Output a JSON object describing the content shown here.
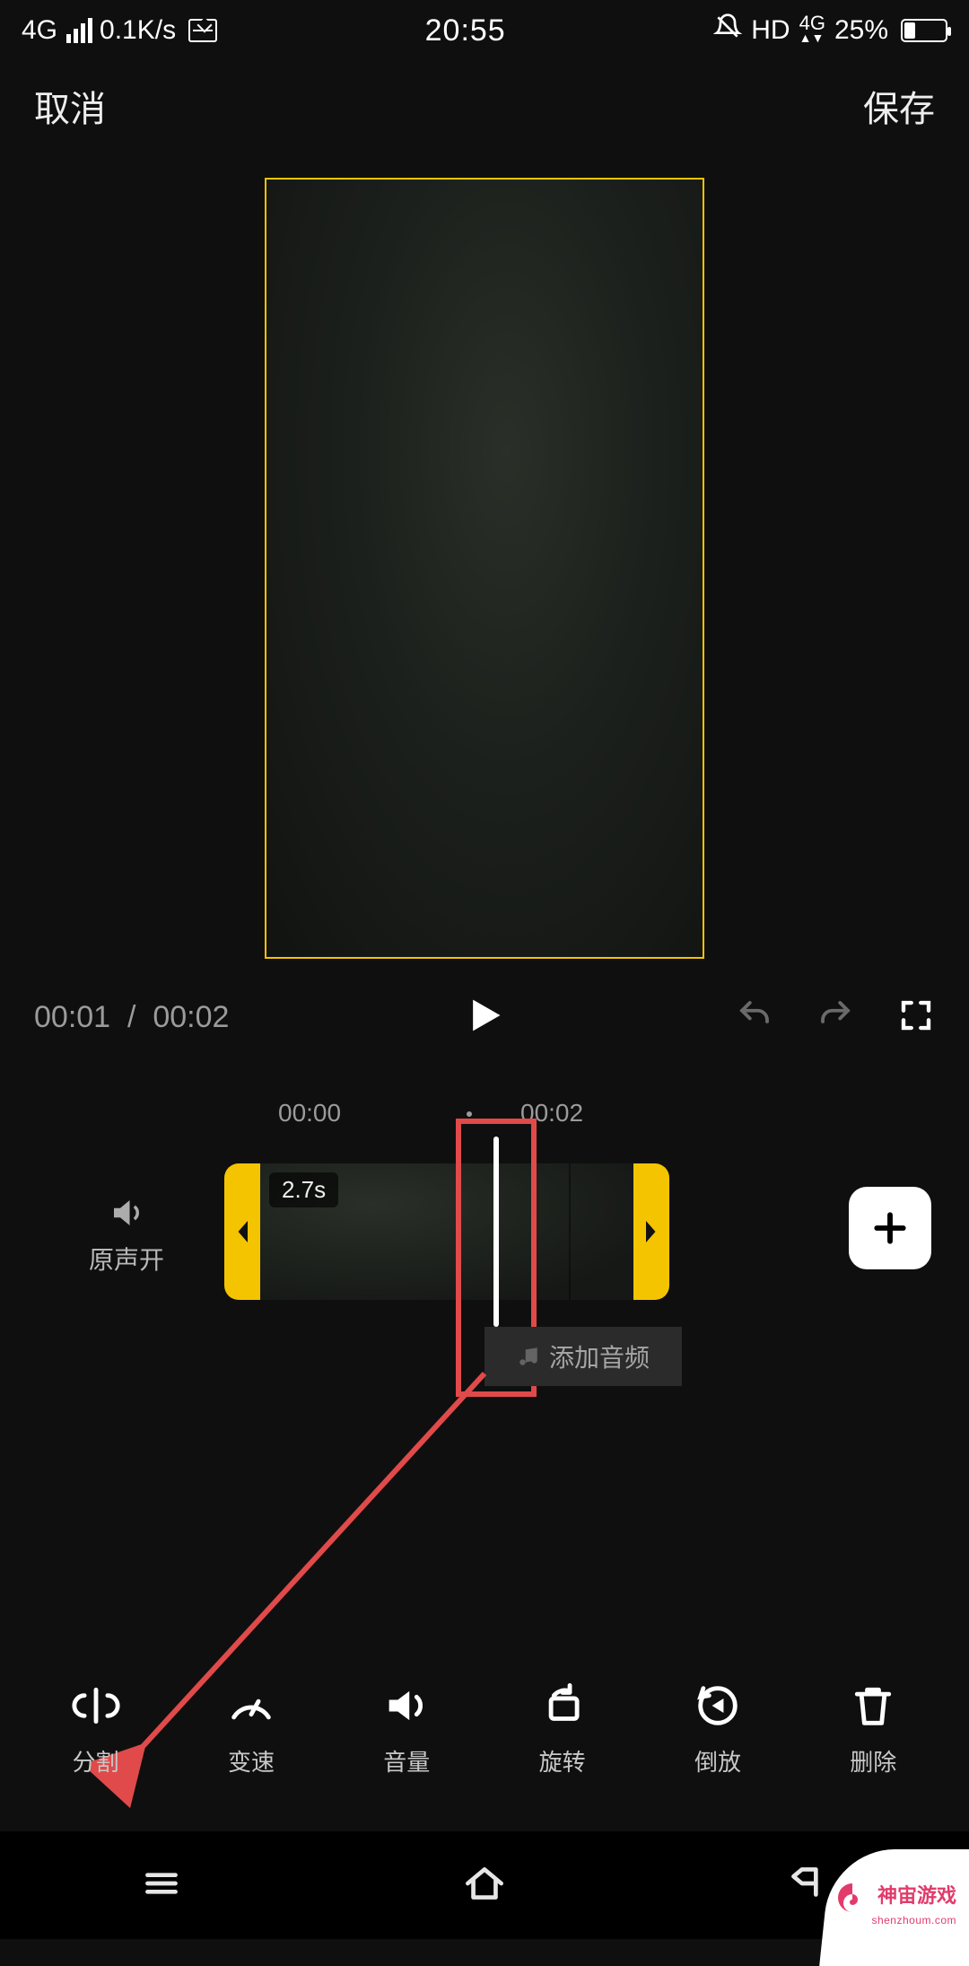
{
  "status": {
    "net_label": "4G",
    "speed": "0.1K/s",
    "time": "20:55",
    "hd": "HD",
    "data": "4G",
    "battery_pct": "25%"
  },
  "actions": {
    "cancel": "取消",
    "save": "保存"
  },
  "playback": {
    "current": "00:01",
    "sep": "/",
    "total": "00:02"
  },
  "ruler": {
    "start": "00:00",
    "end": "00:02"
  },
  "sound": {
    "toggle_label": "原声开"
  },
  "clip": {
    "duration_badge": "2.7s"
  },
  "audio": {
    "add_label": "添加音频"
  },
  "tools": {
    "split": "分割",
    "speed": "变速",
    "volume": "音量",
    "rotate": "旋转",
    "reverse": "倒放",
    "delete": "删除"
  },
  "watermark": {
    "text": "神宙游戏",
    "sub": "shenzhoum.com"
  }
}
